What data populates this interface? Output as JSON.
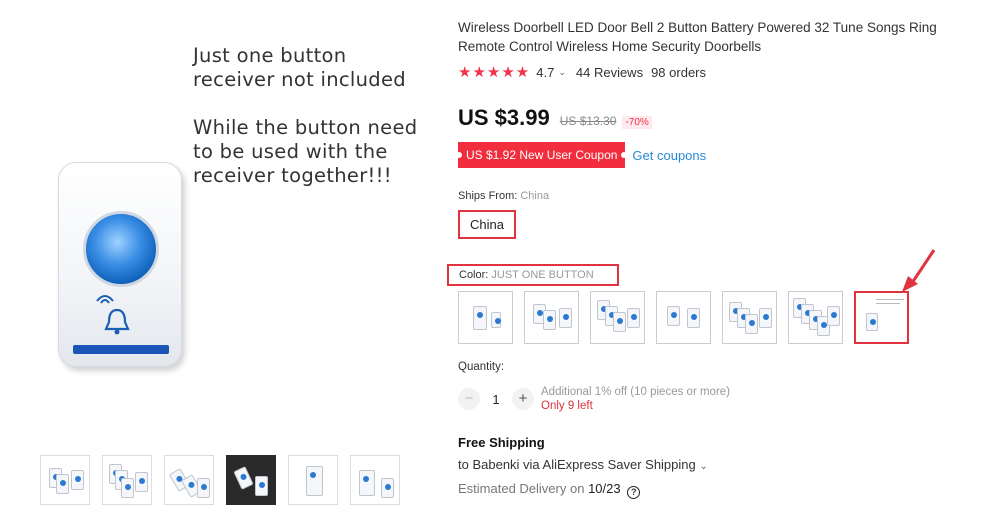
{
  "gallery": {
    "notes": [
      "Just one button\nreceiver not included",
      "While the button need\nto be used with the\nreceiver together!!!"
    ],
    "thumbnails": [
      "thumb-1",
      "thumb-2",
      "thumb-3",
      "thumb-4",
      "thumb-5",
      "thumb-6"
    ],
    "selected_thumbnail": 4
  },
  "product": {
    "title": "Wireless Doorbell LED Door Bell 2 Button Battery Powered 32 Tune Songs Ring Remote Control Wireless Home Security Doorbells",
    "stars": "★★★★★",
    "rating": "4.7",
    "reviews": "44 Reviews",
    "orders": "98 orders"
  },
  "price": {
    "current": "US $3.99",
    "original": "US $13.30",
    "discount": "-70%"
  },
  "coupon": {
    "label": "US $1.92 New User Coupon",
    "link": "Get coupons"
  },
  "ships_from": {
    "label": "Ships From:",
    "value": "China",
    "option": "China"
  },
  "color": {
    "label": "Color:",
    "value": "JUST ONE BUTTON",
    "swatch_count": 7,
    "selected_index": 7
  },
  "quantity": {
    "label": "Quantity:",
    "value": "1",
    "minus": "−",
    "plus": "+",
    "note": "Additional 1% off (10 pieces or more)",
    "stock": "Only 9 left"
  },
  "shipping": {
    "title": "Free Shipping",
    "to_line": "to Babenki via AliExpress Saver Shipping",
    "est_label": "Estimated Delivery on",
    "est_date": "10/23"
  },
  "colors": {
    "accent": "#f22e3e",
    "link": "#2a8bd6",
    "star": "#f0344a"
  }
}
